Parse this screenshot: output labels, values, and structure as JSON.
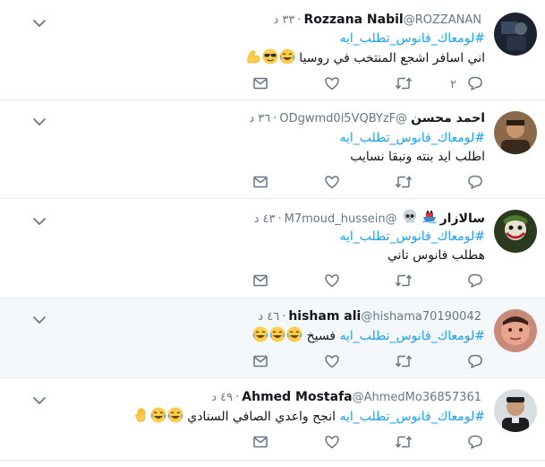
{
  "tweets": [
    {
      "name": "Rozzana Nabil",
      "handle": "@ROZZANAN",
      "time": "٣٣ د",
      "hashtag": "#لومعاك_فانوس_تطلب_ايه",
      "text": "اني اسافر اشجع المنتخب في روسيا",
      "emojis": [
        "laughing-emoji",
        "sunglasses-emoji",
        "flexed-biceps-emoji"
      ],
      "reply_count": "٢"
    },
    {
      "name": "احمد محسن",
      "handle": "@ODgwmd0i5VQBYzF",
      "time": "٣٦ د",
      "hashtag": "#لومعاك_فانوس_تطلب_ايه",
      "text": "اطلب ايد بنته ونبقا نسايب",
      "emojis": [],
      "reply_count": ""
    },
    {
      "name": "سالازار",
      "handle": "@M7moud_hussein",
      "time": "٤٣ د",
      "name_icons": [
        "ship-emoji",
        "skull-emoji"
      ],
      "hashtag": "#لومعاك_فانوس_تطلب_ايه",
      "text": "هطلب فانوس تاني",
      "emojis": [],
      "reply_count": ""
    },
    {
      "name": "hisham ali",
      "handle": "@hishama70190042",
      "time": "٤٦ د",
      "hashtag": "#لومعاك_فانوس_تطلب_ايه",
      "text": "فسيخ",
      "emojis": [
        "laughing-emoji",
        "laughing-emoji",
        "laughing-emoji"
      ],
      "reply_count": ""
    },
    {
      "name": "Ahmed Mostafa",
      "handle": "@AhmedMo36857361",
      "time": "٤٩ د",
      "hashtag": "#لومعاك_فانوس_تطلب_ايه",
      "text": "انجح واعدي الصافي السنادي",
      "emojis": [
        "laughing-emoji",
        "laughing-emoji",
        "raised-hand-emoji"
      ],
      "reply_count": ""
    }
  ],
  "colors": {
    "accent": "#1da1f2",
    "muted": "#657786",
    "text": "#14171a",
    "highlight_bg": "#f5f8fa",
    "divider": "#e6ecf0"
  },
  "icons": [
    "chevron-down-icon",
    "reply-icon",
    "retweet-icon",
    "like-icon",
    "message-icon"
  ]
}
